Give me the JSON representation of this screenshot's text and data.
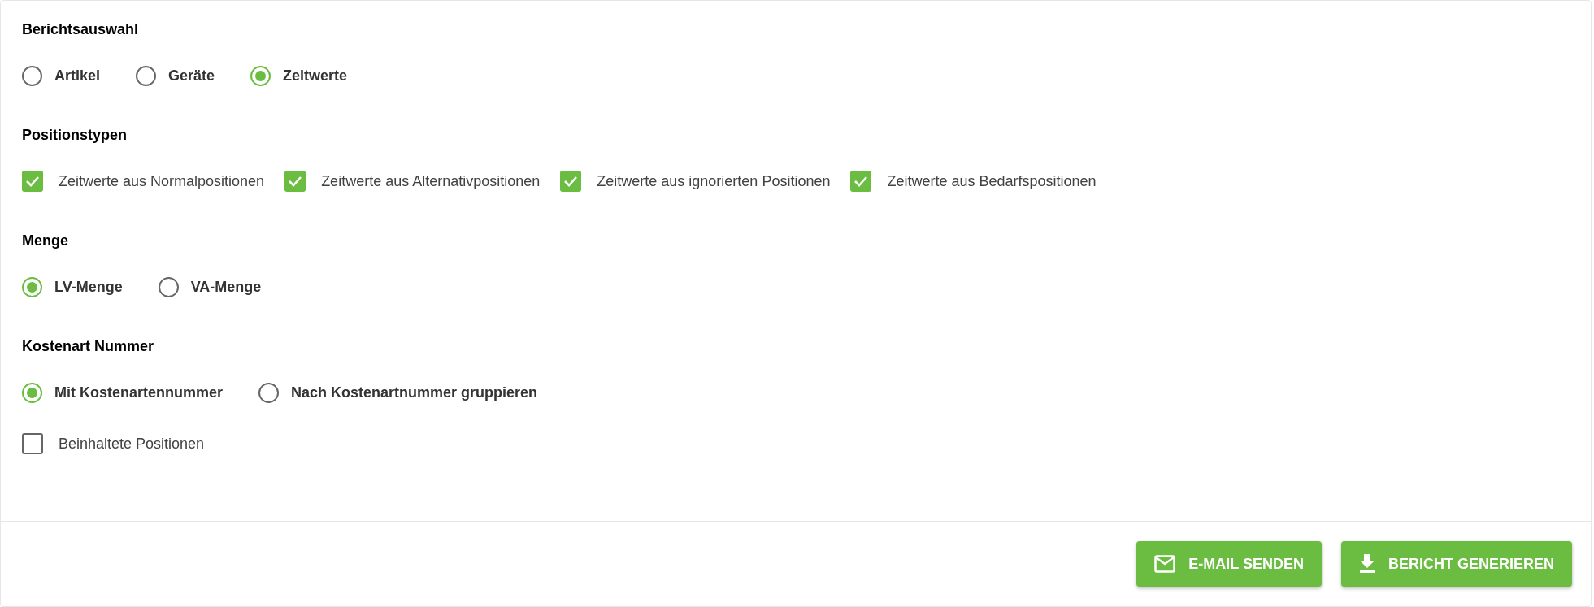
{
  "sections": [
    {
      "title": "Berichtsauswahl",
      "rows": [
        {
          "kind": "radio",
          "items": [
            {
              "label": "Artikel",
              "selected": false
            },
            {
              "label": "Geräte",
              "selected": false
            },
            {
              "label": "Zeitwerte",
              "selected": true
            }
          ]
        }
      ]
    },
    {
      "title": "Positionstypen",
      "rows": [
        {
          "kind": "checkbox",
          "items": [
            {
              "label": "Zeitwerte aus Normalpositionen",
              "checked": true
            },
            {
              "label": "Zeitwerte aus Alternativpositionen",
              "checked": true
            },
            {
              "label": "Zeitwerte aus ignorierten Positionen",
              "checked": true
            },
            {
              "label": "Zeitwerte aus Bedarfspositionen",
              "checked": true
            }
          ]
        }
      ]
    },
    {
      "title": "Menge",
      "rows": [
        {
          "kind": "radio",
          "items": [
            {
              "label": "LV-Menge",
              "selected": true
            },
            {
              "label": "VA-Menge",
              "selected": false
            }
          ]
        }
      ]
    },
    {
      "title": "Kostenart Nummer",
      "rows": [
        {
          "kind": "radio",
          "items": [
            {
              "label": "Mit Kostenartennummer",
              "selected": true
            },
            {
              "label": "Nach Kostenartnummer gruppieren",
              "selected": false
            }
          ]
        },
        {
          "kind": "checkbox",
          "items": [
            {
              "label": "Beinhaltete Positionen",
              "checked": false
            }
          ]
        }
      ]
    }
  ],
  "buttons": [
    "E-MAIL SENDEN",
    "BERICHT GENERIEREN"
  ]
}
